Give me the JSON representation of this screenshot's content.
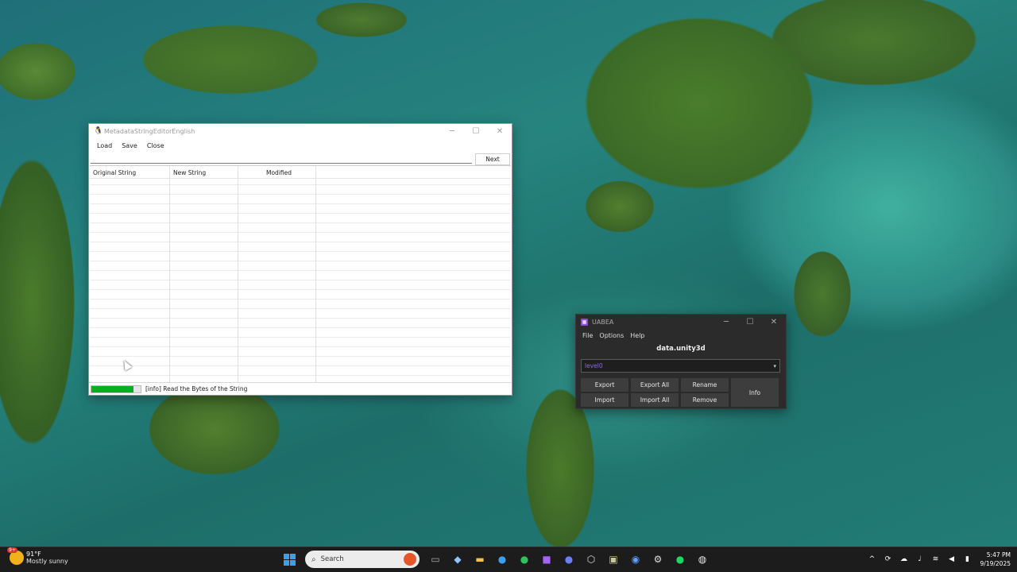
{
  "metadata_editor": {
    "title": "MetadataStringEditorEnglish",
    "menu": [
      "Load",
      "Save",
      "Close"
    ],
    "search_value": "",
    "next_label": "Next",
    "columns": [
      "Original String",
      "New String",
      "Modified"
    ],
    "progress_fraction": 0.85,
    "status_text": "[info] Read the Bytes of the String"
  },
  "uabea": {
    "title": "UABEA",
    "menu": [
      "File",
      "Options",
      "Help"
    ],
    "file_name": "data.unity3d",
    "selected_file": "level0",
    "buttons": {
      "export": "Export",
      "export_all": "Export All",
      "rename": "Rename",
      "import": "Import",
      "import_all": "Import All",
      "remove": "Remove",
      "info": "Info"
    },
    "accent_color": "#8a6be0"
  },
  "taskbar": {
    "weather": {
      "badge": "9+",
      "temp": "91°F",
      "condition": "Mostly sunny"
    },
    "search_placeholder": "Search",
    "apps": [
      "file-manager-icon",
      "copilot-icon",
      "folder-icon",
      "edge-icon",
      "messenger-icon",
      "visual-studio-icon",
      "discord-icon",
      "unity-icon",
      "image-viewer-icon",
      "app-icon",
      "steam-icon",
      "spotify-icon",
      "chrome-icon"
    ],
    "time": "5:47 PM",
    "date": "9/19/2025"
  }
}
